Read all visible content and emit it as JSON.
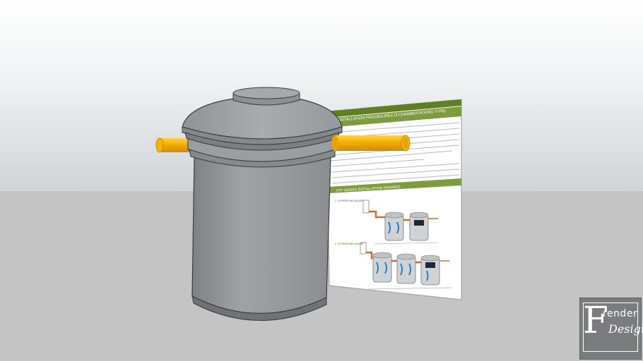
{
  "scene": {
    "sheet": {
      "heading1": "INSTALLATION PROCEDURES (3 CHAMBER ROUND TYPE)",
      "heading2": "PST SERIES INSTALLATION DRAWING",
      "fig1_label": "1. 10 PERSONS HOUSE",
      "fig2_label": "2. 20 PERSONS HOUSE"
    },
    "logo": {
      "letter": "F",
      "word1": "render",
      "word2": "Designs"
    },
    "colors": {
      "sky_top": "#ffffff",
      "ground": "#c4c4c4",
      "tank": "#8f9396",
      "pipe": "#f2a900",
      "sheet_header": "#6b8a2c"
    }
  }
}
